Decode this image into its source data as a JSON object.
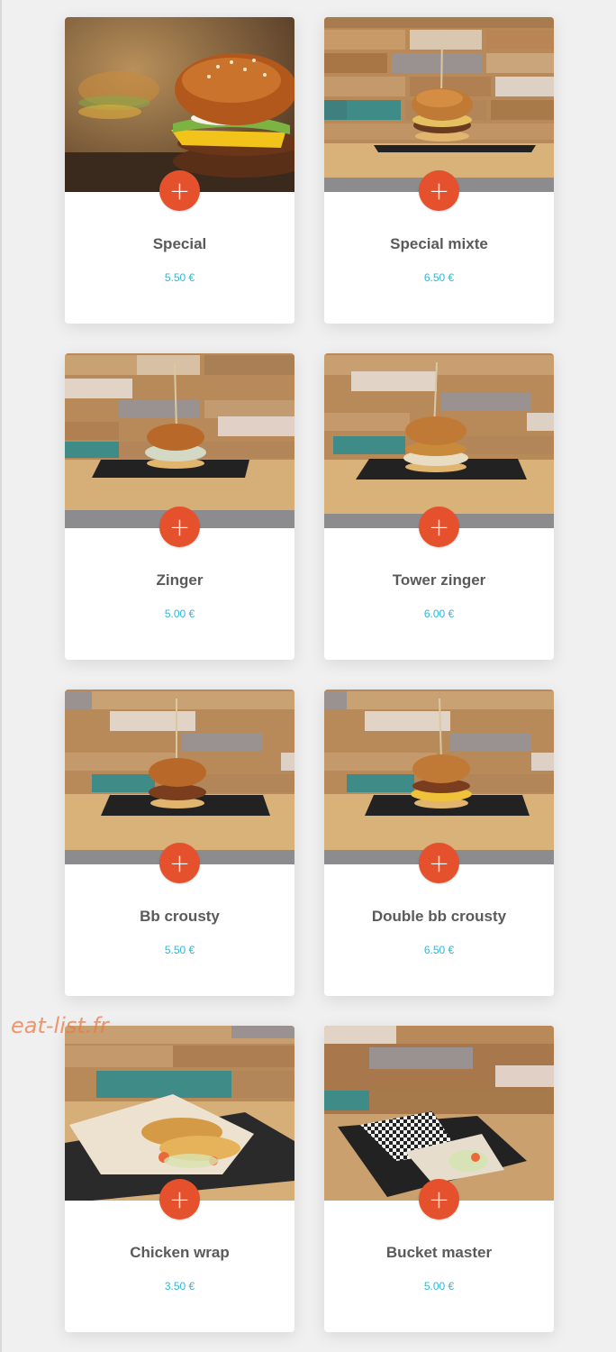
{
  "products": [
    {
      "name": "Special",
      "price": "5.50 €",
      "photo": "burger-closeup"
    },
    {
      "name": "Special mixte",
      "price": "6.50 €",
      "photo": "burger-on-board"
    },
    {
      "name": "Zinger",
      "price": "5.00 €",
      "photo": "burger-on-board"
    },
    {
      "name": "Tower zinger",
      "price": "6.00 €",
      "photo": "burger-on-board"
    },
    {
      "name": "Bb crousty",
      "price": "5.50 €",
      "photo": "burger-on-board"
    },
    {
      "name": "Double bb crousty",
      "price": "6.50 €",
      "photo": "burger-on-board"
    },
    {
      "name": "Chicken wrap",
      "price": "3.50 €",
      "photo": "wrap-on-board"
    },
    {
      "name": "Bucket master",
      "price": "5.00 €",
      "photo": "wrap-checkered"
    }
  ],
  "add_button_icon": "plus-icon",
  "add_button_symbol": "+",
  "watermark": "eat-list.fr",
  "colors": {
    "accent": "#e5512d",
    "price": "#34b5d4",
    "title": "#5a5a5a",
    "background": "#f0f0f0"
  }
}
